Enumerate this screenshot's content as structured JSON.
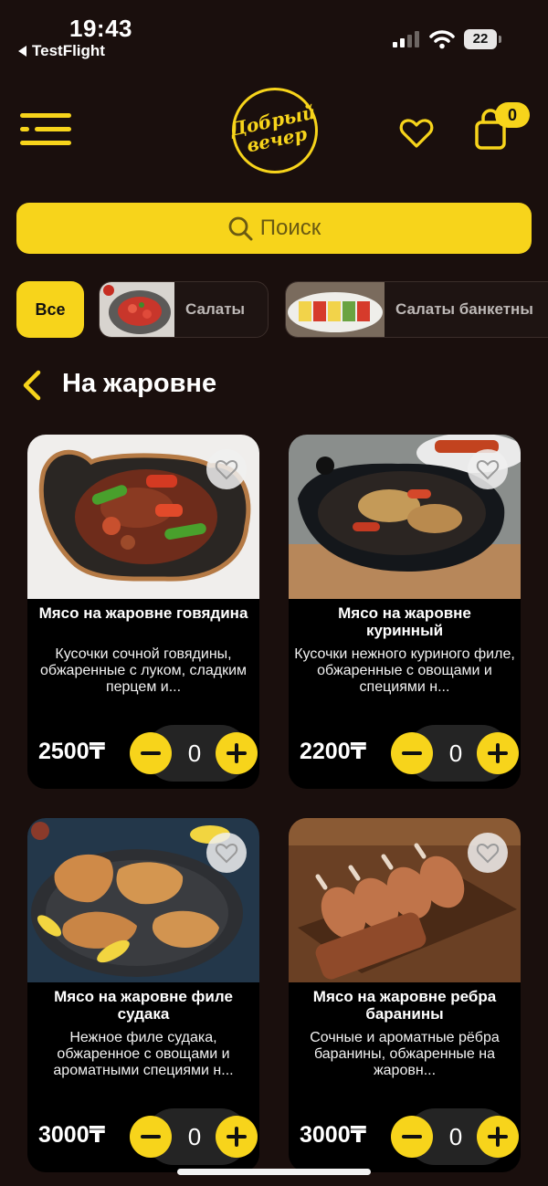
{
  "status_bar": {
    "time": "19:43",
    "back_app": "TestFlight",
    "battery": "22"
  },
  "header": {
    "logo_line1": "Добрый",
    "logo_line2": "вечер",
    "cart_count": "0",
    "accent_color": "#f7d41b"
  },
  "search": {
    "placeholder": "Поиск"
  },
  "categories": {
    "all_label": "Все",
    "items": [
      {
        "label": "Салаты"
      },
      {
        "label": "Салаты банкетны"
      }
    ]
  },
  "section": {
    "title": "На жаровне"
  },
  "products": [
    {
      "title": "Мясо на жаровне говядина",
      "description": "Кусочки сочной говядины, обжаренные с луком, сладким перцем и...",
      "price": "2500₸",
      "quantity": "0"
    },
    {
      "title": "Мясо на жаровне куринный",
      "description": "Кусочки нежного куриного филе, обжаренные с овощами и специями н...",
      "price": "2200₸",
      "quantity": "0"
    },
    {
      "title": "Мясо на жаровне филе судака",
      "description": "Нежное филе судака, обжаренное с овощами и ароматными специями н...",
      "price": "3000₸",
      "quantity": "0"
    },
    {
      "title": "Мясо на жаровне ребра баранины",
      "description": "Сочные и ароматные рёбра баранины, обжаренные на жаровн...",
      "price": "3000₸",
      "quantity": "0"
    }
  ]
}
